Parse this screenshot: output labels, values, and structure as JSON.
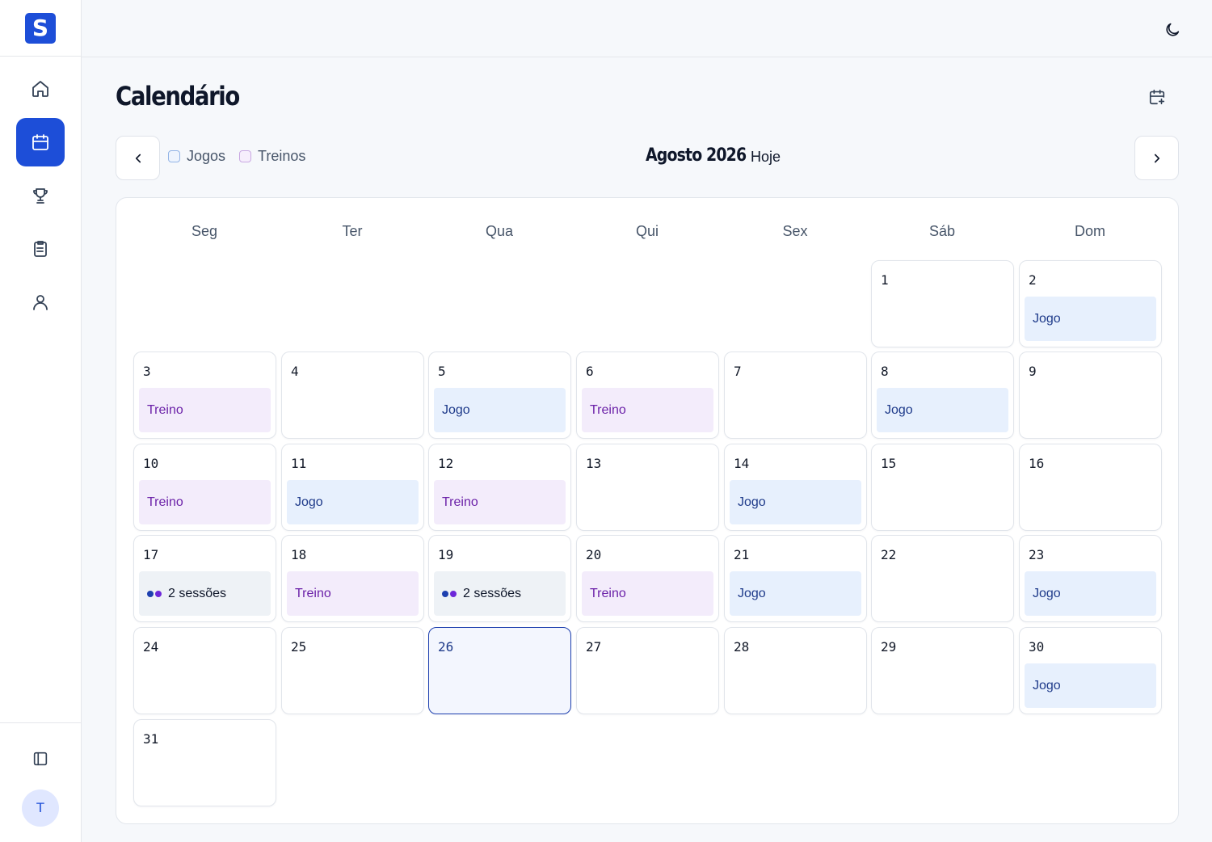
{
  "sidebar": {
    "logo": "S",
    "nav": [
      {
        "icon": "home-icon"
      },
      {
        "icon": "calendar-icon",
        "active": true
      },
      {
        "icon": "trophy-icon"
      },
      {
        "icon": "clipboard-icon"
      },
      {
        "icon": "user-icon"
      }
    ],
    "collapse_icon": "sidebar-toggle-icon",
    "avatar_initial": "T"
  },
  "topbar": {
    "theme_icon": "moon-icon"
  },
  "page": {
    "title": "Calendário",
    "add_icon": "calendar-plus-icon"
  },
  "filters": {
    "jogos": "Jogos",
    "treinos": "Treinos"
  },
  "month_label": "Agosto 2026",
  "today_label": "Hoje",
  "weekdays": [
    "Seg",
    "Ter",
    "Qua",
    "Qui",
    "Sex",
    "Sáb",
    "Dom"
  ],
  "colors": {
    "primary": "#1d4ed8",
    "jogo_bg": "#e7f0fd",
    "jogo_text": "#1e3a8a",
    "treino_bg": "#f3ecfb",
    "treino_text": "#6b21a8"
  },
  "days": [
    {
      "n": "1",
      "event": null
    },
    {
      "n": "2",
      "event": {
        "type": "jogo",
        "label": "Jogo"
      }
    },
    {
      "n": "3",
      "event": {
        "type": "treino",
        "label": "Treino"
      }
    },
    {
      "n": "4",
      "event": null
    },
    {
      "n": "5",
      "event": {
        "type": "jogo",
        "label": "Jogo"
      }
    },
    {
      "n": "6",
      "event": {
        "type": "treino",
        "label": "Treino"
      }
    },
    {
      "n": "7",
      "event": null
    },
    {
      "n": "8",
      "event": {
        "type": "jogo",
        "label": "Jogo"
      }
    },
    {
      "n": "9",
      "event": null
    },
    {
      "n": "10",
      "event": {
        "type": "treino",
        "label": "Treino"
      }
    },
    {
      "n": "11",
      "event": {
        "type": "jogo",
        "label": "Jogo"
      }
    },
    {
      "n": "12",
      "event": {
        "type": "treino",
        "label": "Treino"
      }
    },
    {
      "n": "13",
      "event": null
    },
    {
      "n": "14",
      "event": {
        "type": "jogo",
        "label": "Jogo"
      }
    },
    {
      "n": "15",
      "event": null
    },
    {
      "n": "16",
      "event": null
    },
    {
      "n": "17",
      "event": {
        "type": "multi",
        "label": "2 sessões"
      }
    },
    {
      "n": "18",
      "event": {
        "type": "treino",
        "label": "Treino"
      }
    },
    {
      "n": "19",
      "event": {
        "type": "multi",
        "label": "2 sessões"
      }
    },
    {
      "n": "20",
      "event": {
        "type": "treino",
        "label": "Treino"
      }
    },
    {
      "n": "21",
      "event": {
        "type": "jogo",
        "label": "Jogo"
      }
    },
    {
      "n": "22",
      "event": null
    },
    {
      "n": "23",
      "event": {
        "type": "jogo",
        "label": "Jogo"
      }
    },
    {
      "n": "24",
      "event": null
    },
    {
      "n": "25",
      "event": null
    },
    {
      "n": "26",
      "event": null,
      "today": true
    },
    {
      "n": "27",
      "event": null
    },
    {
      "n": "28",
      "event": null
    },
    {
      "n": "29",
      "event": null
    },
    {
      "n": "30",
      "event": {
        "type": "jogo",
        "label": "Jogo"
      }
    },
    {
      "n": "31",
      "event": null
    }
  ]
}
